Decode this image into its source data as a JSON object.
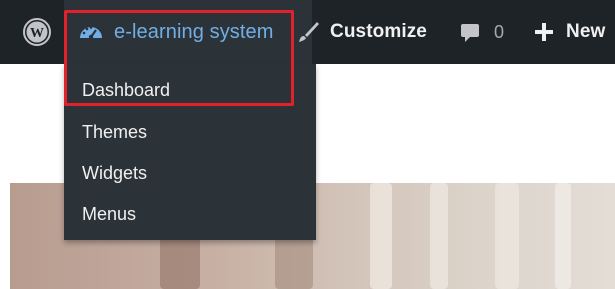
{
  "adminbar": {
    "wp_logo_icon": "wordpress-logo-icon",
    "site_name": "e-learning system",
    "site_icon": "dashboard-gauge-icon",
    "customize_label": "Customize",
    "customize_icon": "paintbrush-icon",
    "comments_icon": "comment-bubble-icon",
    "comments_count": "0",
    "new_icon": "plus-icon",
    "new_label": "New"
  },
  "submenu": {
    "items": [
      {
        "label": "Dashboard"
      },
      {
        "label": "Themes"
      },
      {
        "label": "Widgets"
      },
      {
        "label": "Menus"
      }
    ]
  },
  "colors": {
    "adminbar_bg": "#1d2327",
    "submenu_bg": "#2c3338",
    "site_name_color": "#72aee6",
    "highlight_border": "#e3212b"
  }
}
